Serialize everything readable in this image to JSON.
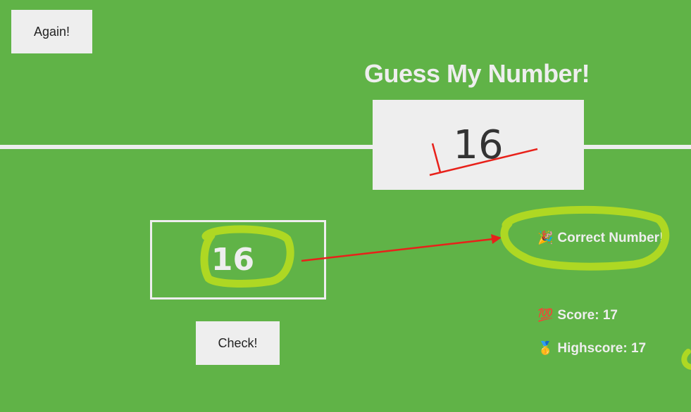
{
  "buttons": {
    "again_label": "Again!",
    "check_label": "Check!"
  },
  "header": {
    "title": "Guess My Number!"
  },
  "secret_number": "16",
  "guess": {
    "value": "16"
  },
  "message": {
    "icon": "party-popper",
    "text": "Correct Number!"
  },
  "score": {
    "icon": "hundred-points",
    "text": "Score: 17"
  },
  "highscore": {
    "icon": "medal",
    "text": "Highscore: 17"
  },
  "colors": {
    "background": "#60b347",
    "panel": "#eeeeee",
    "annotation_red": "#e8211a",
    "annotation_highlight": "#aed823"
  }
}
